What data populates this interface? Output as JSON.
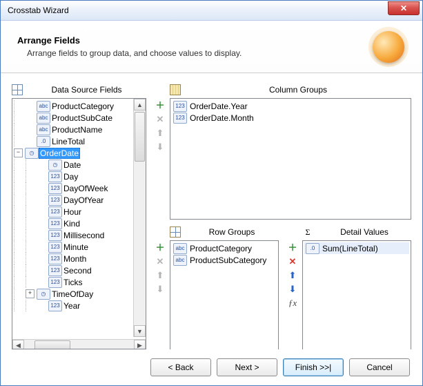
{
  "window": {
    "title": "Crosstab Wizard"
  },
  "header": {
    "title": "Arrange Fields",
    "subtitle": "Arrange fields to group data, and choose values to display."
  },
  "panels": {
    "source": {
      "label": "Data Source Fields"
    },
    "columns": {
      "label": "Column Groups"
    },
    "rows": {
      "label": "Row Groups"
    },
    "details": {
      "label": "Detail Values"
    }
  },
  "icons": {
    "abc": "abc",
    "d10": ".0",
    "d123": "123",
    "sigma": "Σ"
  },
  "source_fields": [
    {
      "indent": 1,
      "expander": null,
      "icon": "abc",
      "label": "ProductCategory"
    },
    {
      "indent": 1,
      "expander": null,
      "icon": "abc",
      "label": "ProductSubCate"
    },
    {
      "indent": 1,
      "expander": null,
      "icon": "abc",
      "label": "ProductName"
    },
    {
      "indent": 1,
      "expander": null,
      "icon": "d10",
      "label": "LineTotal"
    },
    {
      "indent": 0,
      "expander": "minus",
      "icon": "clock",
      "label": "OrderDate",
      "selected": true
    },
    {
      "indent": 2,
      "expander": null,
      "icon": "clock",
      "label": "Date"
    },
    {
      "indent": 2,
      "expander": null,
      "icon": "d123",
      "label": "Day"
    },
    {
      "indent": 2,
      "expander": null,
      "icon": "d123",
      "label": "DayOfWeek"
    },
    {
      "indent": 2,
      "expander": null,
      "icon": "d123",
      "label": "DayOfYear"
    },
    {
      "indent": 2,
      "expander": null,
      "icon": "d123",
      "label": "Hour"
    },
    {
      "indent": 2,
      "expander": null,
      "icon": "d123",
      "label": "Kind"
    },
    {
      "indent": 2,
      "expander": null,
      "icon": "d123",
      "label": "Millisecond"
    },
    {
      "indent": 2,
      "expander": null,
      "icon": "d123",
      "label": "Minute"
    },
    {
      "indent": 2,
      "expander": null,
      "icon": "d123",
      "label": "Month"
    },
    {
      "indent": 2,
      "expander": null,
      "icon": "d123",
      "label": "Second"
    },
    {
      "indent": 2,
      "expander": null,
      "icon": "d123",
      "label": "Ticks"
    },
    {
      "indent": 1,
      "expander": "plus",
      "icon": "clock",
      "label": "TimeOfDay"
    },
    {
      "indent": 2,
      "expander": null,
      "icon": "d123",
      "label": "Year"
    }
  ],
  "column_groups": [
    {
      "icon": "d123",
      "label": "OrderDate.Year"
    },
    {
      "icon": "d123",
      "label": "OrderDate.Month"
    }
  ],
  "row_groups": [
    {
      "icon": "abc",
      "label": "ProductCategory"
    },
    {
      "icon": "abc",
      "label": "ProductSubCategory"
    }
  ],
  "detail_values": [
    {
      "icon": "d10",
      "label": "Sum(LineTotal)",
      "selected": true
    }
  ],
  "buttons": {
    "back": "< Back",
    "next": "Next >",
    "finish": "Finish >>|",
    "cancel": "Cancel"
  }
}
